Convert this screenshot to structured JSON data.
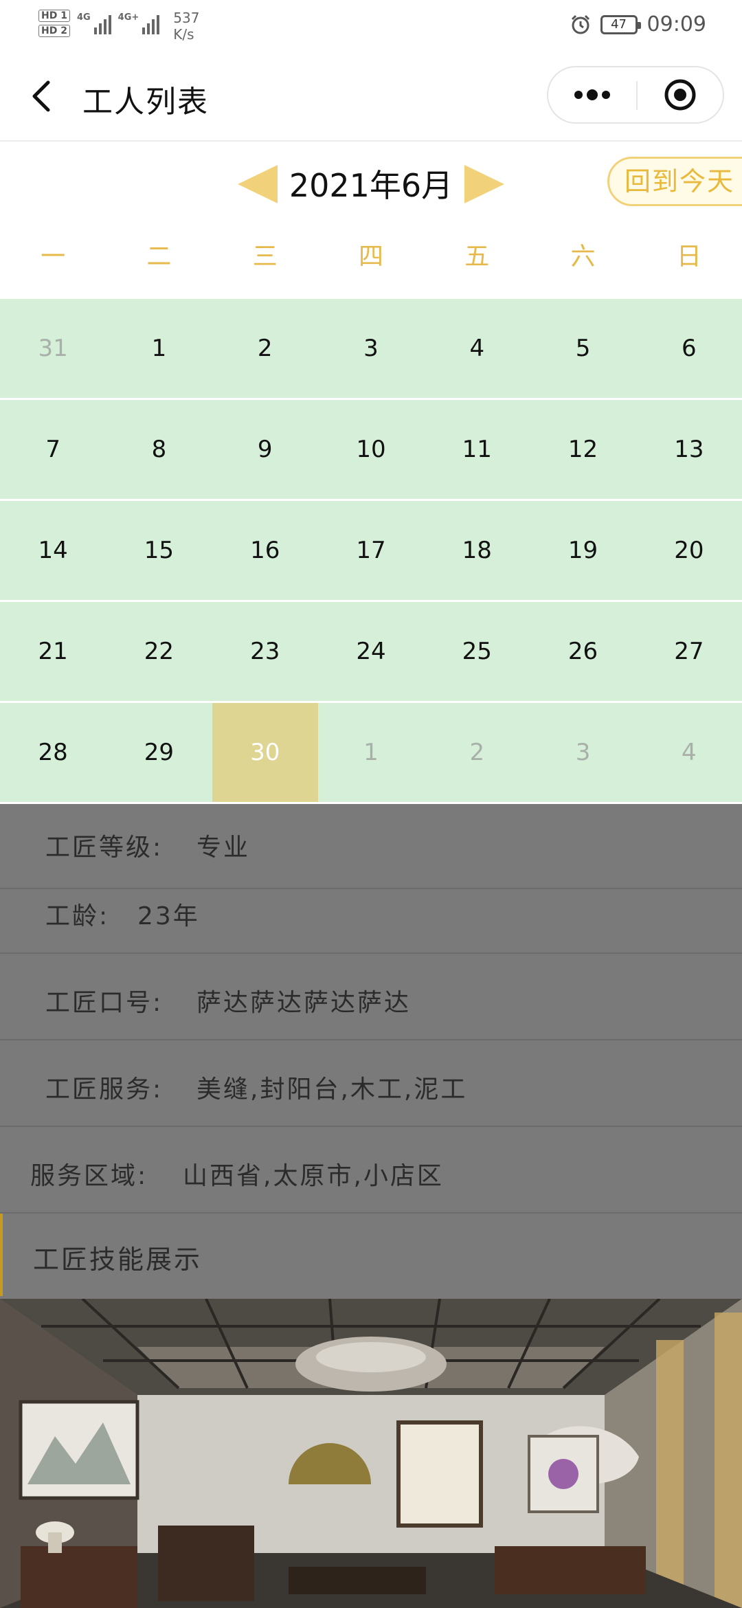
{
  "status_bar": {
    "sim1": "HD 1",
    "sim2": "HD 2",
    "net1": "4G",
    "net2": "4G+",
    "speed_value": "537",
    "speed_unit": "K/s",
    "battery": "47",
    "time": "09:09"
  },
  "nav": {
    "title": "工人列表",
    "icons": [
      "back-icon",
      "more-icon",
      "target-icon"
    ]
  },
  "calendar": {
    "month_label": "2021年6月",
    "today_button": "回到今天",
    "weekdays": [
      "一",
      "二",
      "三",
      "四",
      "五",
      "六",
      "日"
    ],
    "weeks": [
      [
        "31",
        "1",
        "2",
        "3",
        "4",
        "5",
        "6"
      ],
      [
        "7",
        "8",
        "9",
        "10",
        "11",
        "12",
        "13"
      ],
      [
        "14",
        "15",
        "16",
        "17",
        "18",
        "19",
        "20"
      ],
      [
        "21",
        "22",
        "23",
        "24",
        "25",
        "26",
        "27"
      ],
      [
        "28",
        "29",
        "30",
        "1",
        "2",
        "3",
        "4"
      ]
    ],
    "selected_day": "30",
    "colors": {
      "accent": "#f1d27a",
      "weekday": "#e6b94a",
      "cell_bg": "#d5efd8",
      "selected_bg": "#dfd592"
    }
  },
  "info": {
    "level_label": "工匠等级:",
    "level_value": "专业",
    "age_label": "工龄:",
    "age_value": "23年",
    "slogan_label": "工匠口号:",
    "slogan_value": "萨达萨达萨达萨达",
    "service_label": "工匠服务:",
    "service_value": "美缝,封阳台,木工,泥工",
    "area_label": "服务区域:",
    "area_value": "山西省,太原市,小店区",
    "skills_title": "工匠技能展示"
  }
}
